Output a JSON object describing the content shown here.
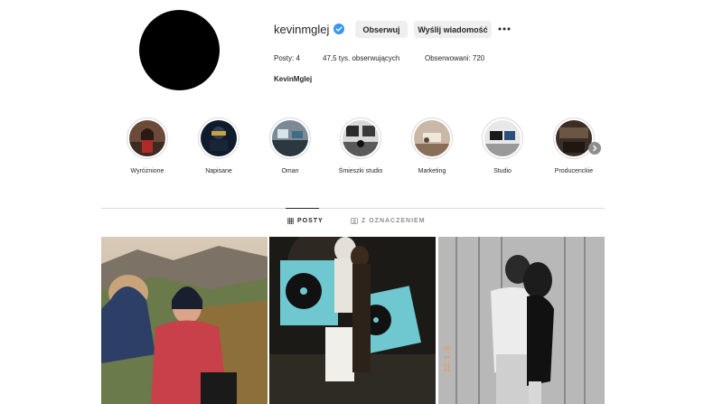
{
  "profile": {
    "username": "kevinmglej",
    "full_name": "KevinMglej",
    "follow_label": "Obserwuj",
    "message_label": "Wyślij wiadomość",
    "stats": {
      "posts": "Posty: 4",
      "followers": "47,5 tys. obserwujących",
      "following": "Obserwowani: 720"
    }
  },
  "highlights": [
    {
      "label": "Wyróżnione"
    },
    {
      "label": "Napisane"
    },
    {
      "label": "Oman"
    },
    {
      "label": "Śmieszki studio"
    },
    {
      "label": "Marketing"
    },
    {
      "label": "Studio"
    },
    {
      "label": "Producenckie"
    }
  ],
  "tabs": {
    "posts": "POSTY",
    "tagged": "Z OZNACZENIEM"
  },
  "colors": {
    "verified": "#3897f0",
    "button_bg": "#efefef",
    "divider": "#dbdbdb"
  },
  "icons": {
    "verified": "verified-badge-icon",
    "more": "more-options-icon",
    "posts_tab": "grid-icon",
    "tagged_tab": "tagged-icon",
    "highlights_next": "chevron-right-icon"
  }
}
